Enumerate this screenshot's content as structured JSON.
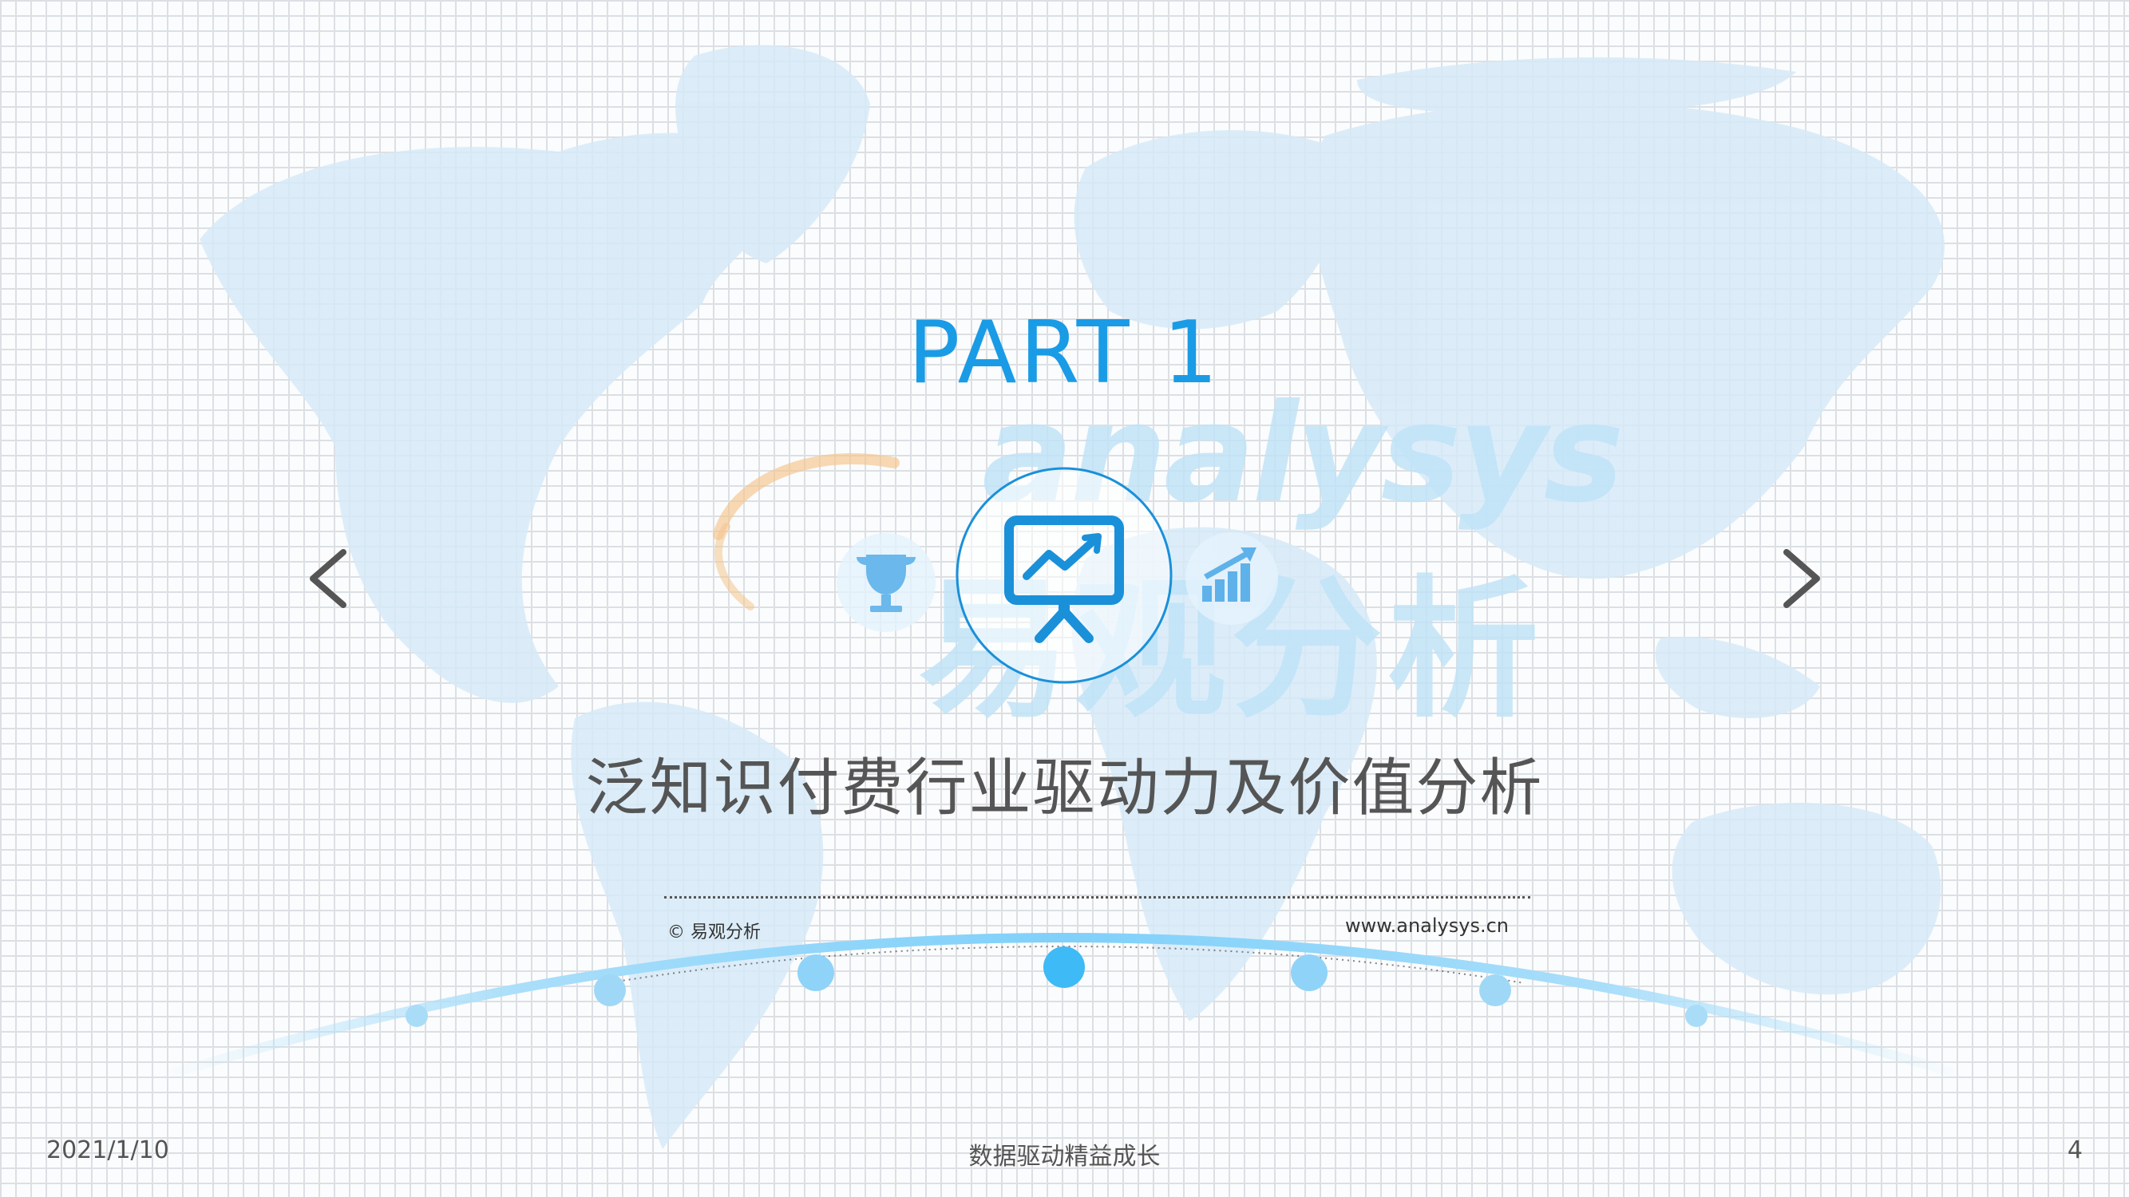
{
  "slide": {
    "part_title": "PART 1",
    "subtitle": "泛知识付费行业驱动力及价值分析",
    "copyright": "© 易观分析",
    "website": "www.analysys.cn",
    "watermark_en": "analysys",
    "watermark_cn": "易观分析"
  },
  "footer": {
    "date": "2021/1/10",
    "center": "数据驱动精益成长",
    "page_number": "4"
  },
  "icons": {
    "main": "presentation-chart-icon",
    "left": "trophy-icon",
    "right": "bar-chart-growth-icon",
    "prev": "chevron-left-icon",
    "next": "chevron-right-icon"
  },
  "colors": {
    "accent": "#1a9be6",
    "map": "#d9ecf8",
    "text": "#555555"
  }
}
